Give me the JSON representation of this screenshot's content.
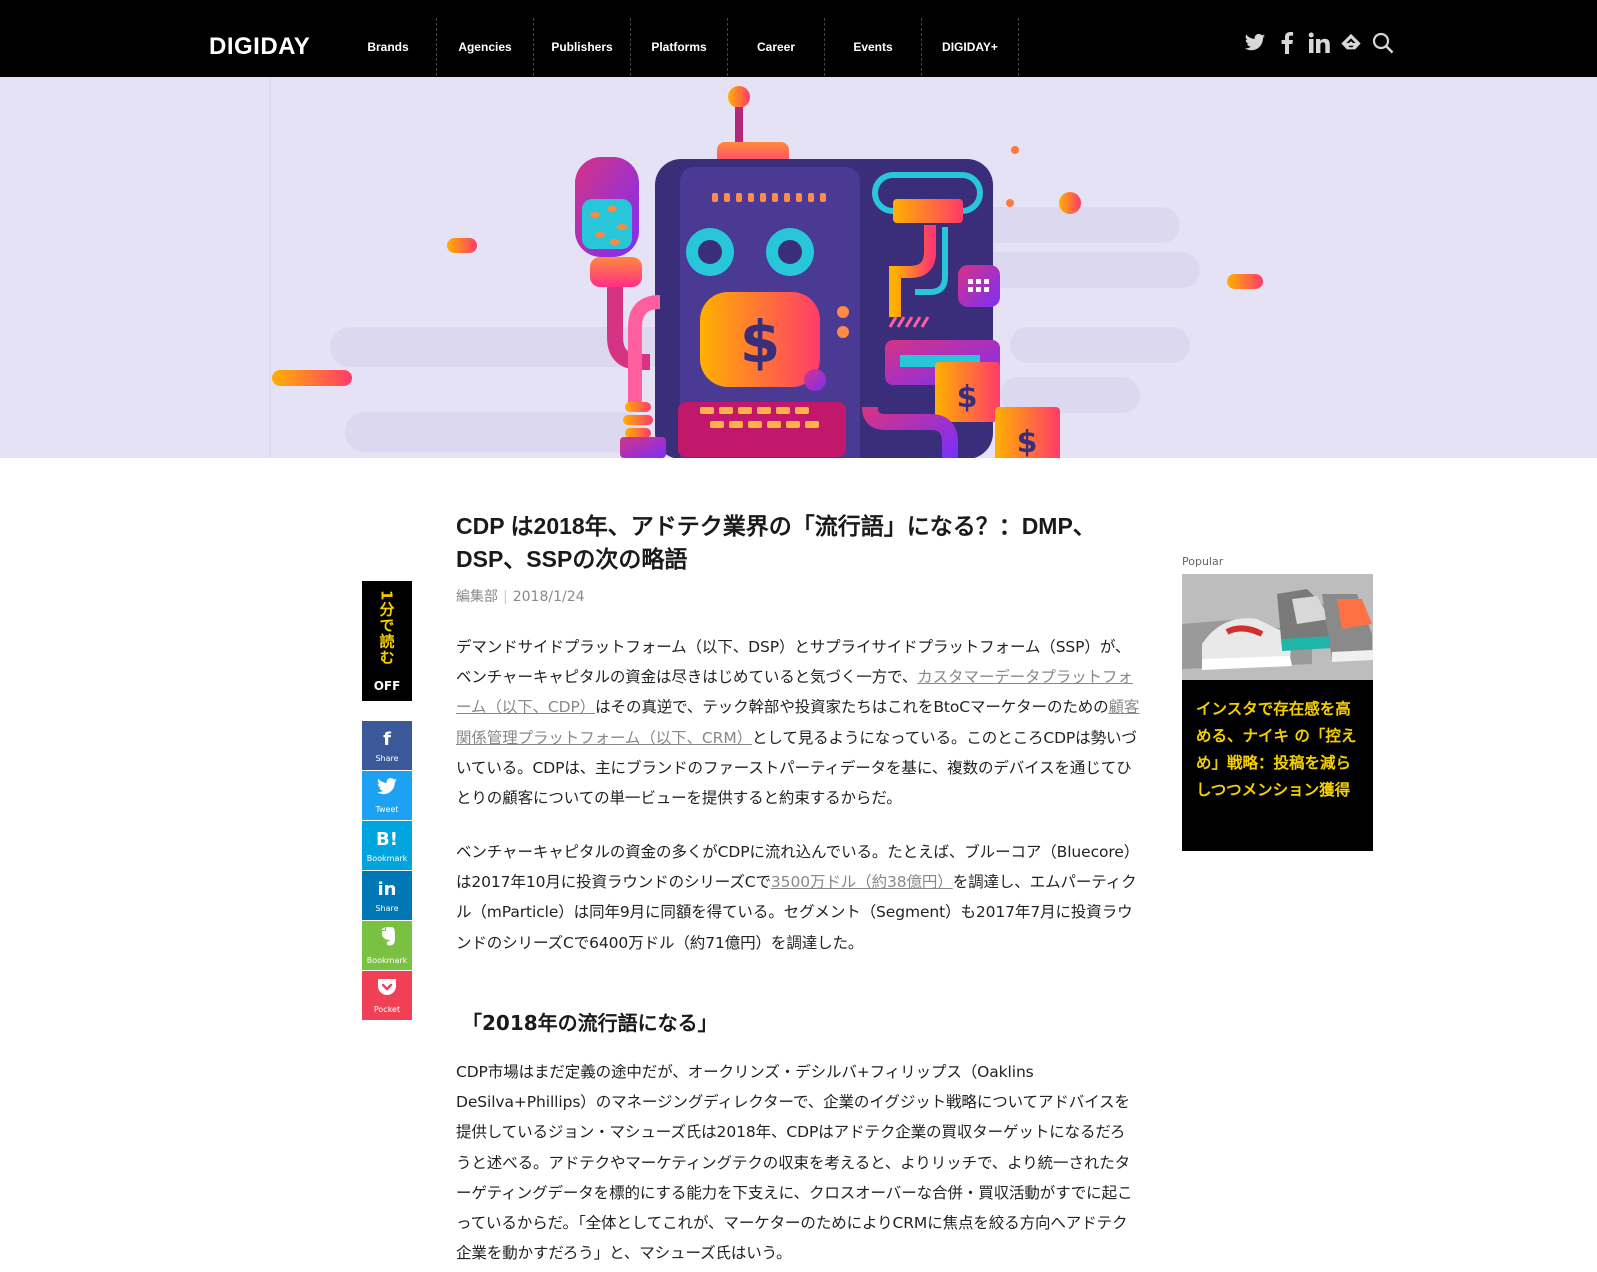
{
  "header": {
    "logo": "DIGIDAY",
    "nav": [
      "Brands",
      "Agencies",
      "Publishers",
      "Platforms",
      "Career",
      "Events",
      "DIGIDAY+"
    ],
    "social_icons": [
      "twitter-icon",
      "facebook-icon",
      "linkedin-icon",
      "feedly-icon",
      "search-icon"
    ]
  },
  "article": {
    "title": "CDP は2018年、アドテク業界の「流行語」になる？：DMP、DSP、SSPの次の略語",
    "author": "編集部",
    "date": "2018/1/24",
    "p1_a": "デマンドサイドプラットフォーム（以下、DSP）とサプライサイドプラットフォーム（SSP）が、ベンチャーキャピタルの資金は尽きはじめていると気づく一方で、",
    "p1_link1": "カスタマーデータプラットフォーム（以下、CDP）",
    "p1_b": "はその真逆で、テック幹部や投資家たちはこれをBtoCマーケターのための",
    "p1_link2": "顧客関係管理プラットフォーム（以下、CRM）",
    "p1_c": "として見るようになっている。このところCDPは勢いづいている。CDPは、主にブランドのファーストパーティデータを基に、複数のデバイスを通じてひとりの顧客についての単一ビューを提供すると約束するからだ。",
    "p2_a": "ベンチャーキャピタルの資金の多くがCDPに流れ込んでいる。たとえば、ブルーコア（Bluecore）は2017年10月に投資ラウンドのシリーズCで",
    "p2_link": "3500万ドル（約38億円）",
    "p2_b": "を調達し、エムパーティクル（mParticle）は同年9月に同額を得ている。セグメント（Segment）も2017年7月に投資ラウンドのシリーズCで6400万ドル（約71億円）を調達した。",
    "h2": "「2018年の流行語になる」",
    "p3": "CDP市場はまだ定義の途中だが、オークリンズ・デシルバ+フィリップス（Oaklins DeSilva+Phillips）のマネージングディレクターで、企業のイグジット戦略についてアドバイスを提供しているジョン・マシューズ氏は2018年、CDPはアドテク企業の買収ターゲットになるだろうと述べる。アドテクやマーケティングテクの収束を考えると、よりリッチで、より統一されたターゲティングデータを標的にする能力を下支えに、クロスオーバーな合併・買収活動がすでに起こっているからだ。「全体としてこれが、マーケターのためによりCRMに焦点を絞る方向へアドテク企業を動かすだろう」と、マシューズ氏はいう。"
  },
  "read_widget": {
    "label": "1分で読む",
    "state": "OFF"
  },
  "share_buttons": [
    {
      "glyph": "f",
      "label": "Share",
      "color": "#3b5998"
    },
    {
      "glyph": "🐦",
      "label": "Tweet",
      "color": "#1da1f2"
    },
    {
      "glyph": "B!",
      "label": "Bookmark",
      "color": "#00a4de"
    },
    {
      "glyph": "in",
      "label": "Share",
      "color": "#0077b5"
    },
    {
      "glyph": "🐘",
      "label": "Bookmark",
      "color": "#7ac142"
    },
    {
      "glyph": "♥",
      "label": "Pocket",
      "color": "#ef4056"
    }
  ],
  "popular": {
    "label": "Popular",
    "title": "インスタで存在感を高める、ナイキ の「控えめ」戦略：投稿を減らしつつメンション獲得"
  },
  "colors": {
    "nav_bg": "#000000",
    "hero_bg": "#e6e2f6",
    "popular_title": "#f5d000"
  }
}
